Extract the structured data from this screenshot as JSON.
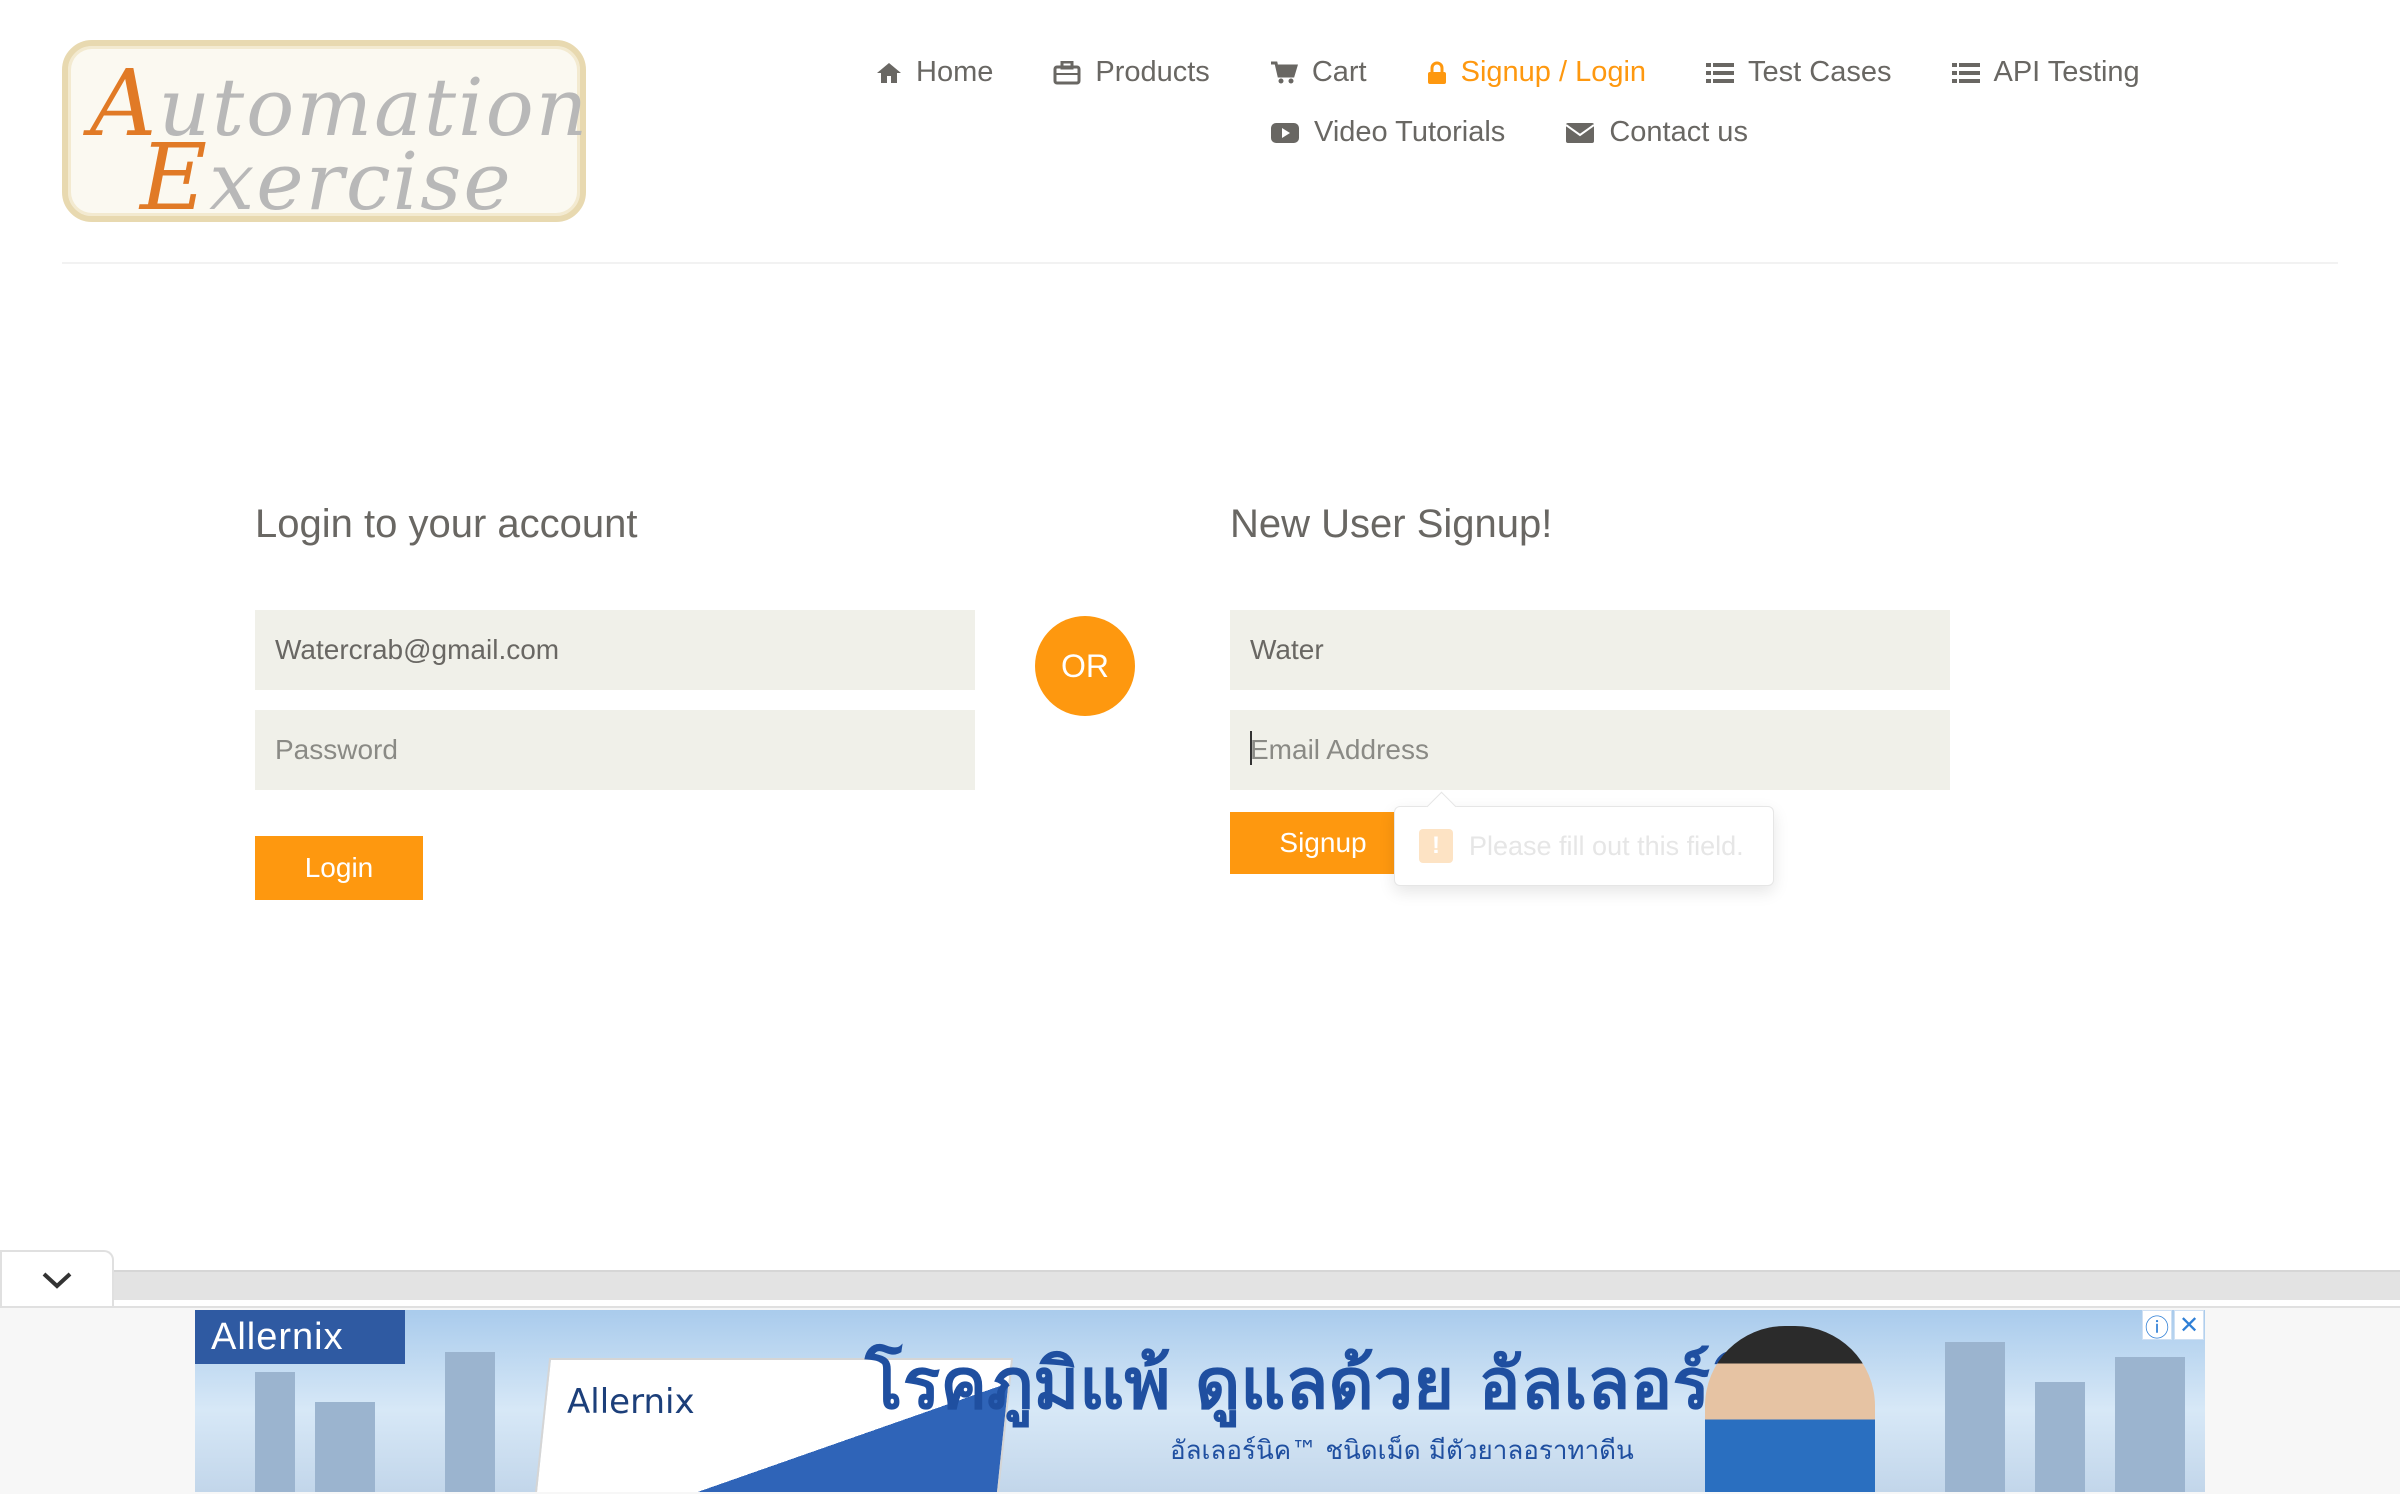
{
  "logo": {
    "line1": "Automation",
    "line2": "Exercise"
  },
  "nav": {
    "row1": [
      {
        "label": "Home",
        "icon": "home-icon"
      },
      {
        "label": "Products",
        "icon": "briefcase-icon"
      },
      {
        "label": "Cart",
        "icon": "cart-icon"
      },
      {
        "label": "Signup / Login",
        "icon": "lock-icon",
        "active": true
      },
      {
        "label": "Test Cases",
        "icon": "list-icon"
      },
      {
        "label": "API Testing",
        "icon": "list-icon"
      }
    ],
    "row2": [
      {
        "label": "Video Tutorials",
        "icon": "youtube-play-icon"
      },
      {
        "label": "Contact us",
        "icon": "envelope-icon"
      }
    ],
    "active_color": "#fe980f"
  },
  "login": {
    "title": "Login to your account",
    "email_value": "Watercrab@gmail.com",
    "password_placeholder": "Password",
    "button": "Login"
  },
  "or_label": "OR",
  "signup": {
    "title": "New User Signup!",
    "name_value": "Water",
    "email_placeholder": "Email Address",
    "button": "Signup",
    "validation_message": "Please fill out this field.",
    "validation_icon": "!"
  },
  "ad": {
    "brand": "Allernix",
    "product": "Allernix",
    "headline": "โรคภูมิแพ้ ดูแลด้วย อัลเลอร์นิค",
    "subline": "อัลเลอร์นิค™ ชนิดเม็ด มีตัวยาลอราทาดีน",
    "info_icon": "ⓘ",
    "close_icon": "✕"
  },
  "colors": {
    "accent": "#fe980f",
    "input_bg": "#f0f0e9",
    "text": "#696763"
  }
}
